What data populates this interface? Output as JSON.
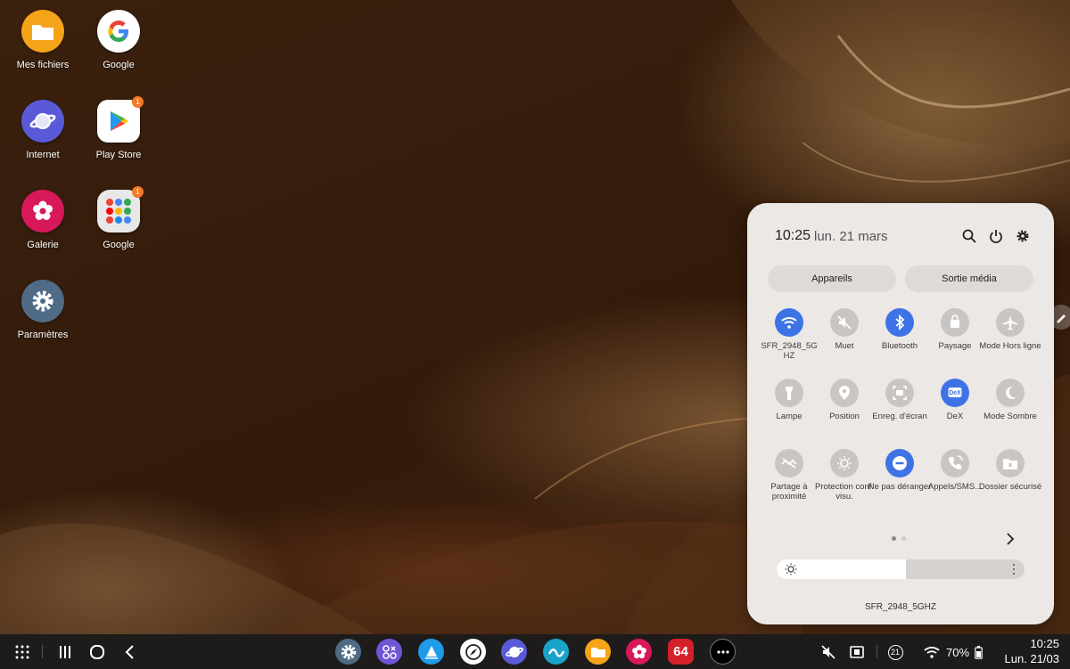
{
  "desktop": {
    "icons": [
      {
        "label": "Mes fichiers",
        "icon": "folder-icon",
        "color": "#f6a417"
      },
      {
        "label": "Google",
        "icon": "google-icon",
        "color": "#ffffff"
      },
      {
        "label": "Internet",
        "icon": "planet-icon",
        "color": "#5a5ad8"
      },
      {
        "label": "Play Store",
        "icon": "play-store-icon",
        "color": "#ffffff",
        "badge": "1"
      },
      {
        "label": "Galerie",
        "icon": "flower-icon",
        "color": "#d8185a"
      },
      {
        "label": "Google",
        "icon": "google-folder-icon",
        "color": "#e8e8e8",
        "badge": "1"
      },
      {
        "label": "Paramètres",
        "icon": "gear-icon",
        "color": "#4f6b85"
      }
    ]
  },
  "quick_panel": {
    "time": "10:25",
    "date": "lun. 21 mars",
    "buttons": {
      "devices": "Appareils",
      "media": "Sortie média"
    },
    "tiles": [
      {
        "label": "SFR_2948_5G HZ",
        "icon": "wifi-icon",
        "on": true
      },
      {
        "label": "Muet",
        "icon": "mute-icon",
        "on": false
      },
      {
        "label": "Bluetooth",
        "icon": "bluetooth-icon",
        "on": true
      },
      {
        "label": "Paysage",
        "icon": "rotation-lock-icon",
        "on": false
      },
      {
        "label": "Mode Hors ligne",
        "icon": "airplane-icon",
        "on": false
      },
      {
        "label": "Lampe",
        "icon": "flashlight-icon",
        "on": false
      },
      {
        "label": "Position",
        "icon": "location-icon",
        "on": false
      },
      {
        "label": "Enreg. d'écran",
        "icon": "screen-record-icon",
        "on": false
      },
      {
        "label": "DeX",
        "icon": "dex-icon",
        "on": true
      },
      {
        "label": "Mode Sombre",
        "icon": "moon-icon",
        "on": false
      },
      {
        "label": "Partage à proximité",
        "icon": "nearby-share-icon",
        "on": false
      },
      {
        "label": "Protection conf. visu.",
        "icon": "eye-comfort-icon",
        "on": false
      },
      {
        "label": "Ne pas déranger",
        "icon": "do-not-disturb-icon",
        "on": true
      },
      {
        "label": "Appels/SMS...",
        "icon": "calls-sms-icon",
        "on": false
      },
      {
        "label": "Dossier sécurisé",
        "icon": "secure-folder-icon",
        "on": false
      }
    ],
    "dex_text": "DeX",
    "page_count": 2,
    "active_page": 1,
    "brightness": 0.52,
    "wifi_name": "SFR_2948_5GHZ"
  },
  "taskbar": {
    "apps": [
      {
        "name": "gear-icon",
        "color": "#4f6b85"
      },
      {
        "name": "apps-edge-icon",
        "color": "#6f56d6"
      },
      {
        "name": "sail-icon",
        "color": "#1f9be8"
      },
      {
        "name": "compass-icon",
        "color": "#ffffff"
      },
      {
        "name": "planet-icon",
        "color": "#5a5ad8"
      },
      {
        "name": "wave-icon",
        "color": "#1aa3c9"
      },
      {
        "name": "folder-icon",
        "color": "#f6a417"
      },
      {
        "name": "flower-icon",
        "color": "#d8185a"
      },
      {
        "name": "app-64-icon",
        "color": "#d4202a",
        "text": "64"
      },
      {
        "name": "more-apps-icon",
        "color": "#000000"
      }
    ],
    "notification_count": "21",
    "battery": "70%",
    "clock_time": "10:25",
    "clock_date": "Lun. 21/03"
  },
  "colors": {
    "accent": "#3e73e6",
    "panel": "#ece8e6"
  }
}
